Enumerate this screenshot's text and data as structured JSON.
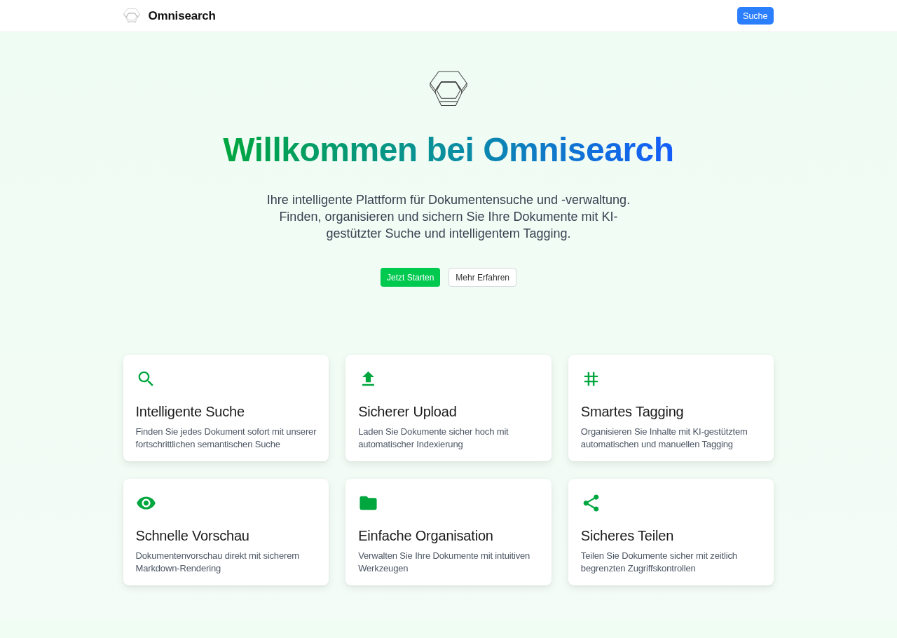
{
  "header": {
    "brand": "Omnisearch",
    "search_button": "Suche"
  },
  "hero": {
    "title": "Willkommen bei Omnisearch",
    "subtitle": "Ihre intelligente Plattform für Dokumentensuche und -verwaltung. Finden, organisieren und sichern Sie Ihre Dokumente mit KI-gestützter Suche und intelligentem Tagging.",
    "buttons": [
      {
        "label": "Jetzt Starten",
        "kind": "primary"
      },
      {
        "label": "Mehr Erfahren",
        "kind": "secondary"
      }
    ]
  },
  "features": [
    {
      "title": "Intelligente Suche",
      "description": "Finden Sie jedes Dokument sofort mit unserer fortschrittlichen semantischen Suche"
    },
    {
      "title": "Sicherer Upload",
      "description": "Laden Sie Dokumente sicher hoch mit automatischer Indexierung"
    },
    {
      "title": "Smartes Tagging",
      "description": "Organisieren Sie Inhalte mit KI-gestütztem automatischen und manuellen Tagging"
    },
    {
      "title": "Schnelle Vorschau",
      "description": "Dokumentenvorschau direkt mit sicherem Markdown-Rendering"
    },
    {
      "title": "Einfache Organisation",
      "description": "Verwalten Sie Ihre Dokumente mit intuitiven Werkzeugen"
    },
    {
      "title": "Sicheres Teilen",
      "description": "Teilen Sie Dokumente sicher mit zeitlich begrenzten Zugriffskontrollen"
    }
  ]
}
